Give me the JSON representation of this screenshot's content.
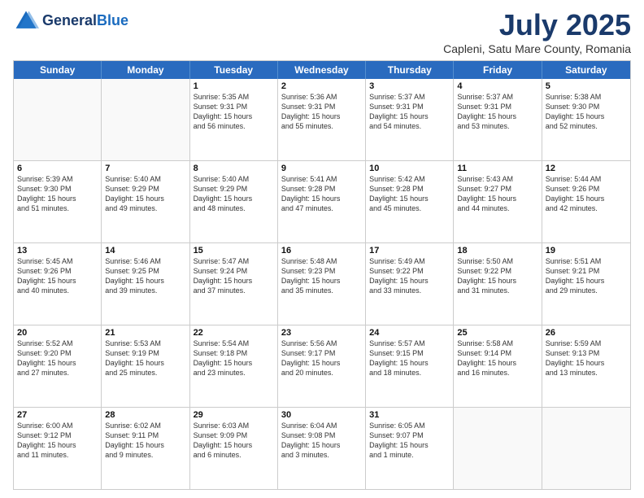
{
  "header": {
    "logo_general": "General",
    "logo_blue": "Blue",
    "main_title": "July 2025",
    "subtitle": "Capleni, Satu Mare County, Romania"
  },
  "calendar": {
    "days": [
      "Sunday",
      "Monday",
      "Tuesday",
      "Wednesday",
      "Thursday",
      "Friday",
      "Saturday"
    ],
    "rows": [
      [
        {
          "day": "",
          "empty": true
        },
        {
          "day": "",
          "empty": true
        },
        {
          "day": "1",
          "lines": [
            "Sunrise: 5:35 AM",
            "Sunset: 9:31 PM",
            "Daylight: 15 hours",
            "and 56 minutes."
          ]
        },
        {
          "day": "2",
          "lines": [
            "Sunrise: 5:36 AM",
            "Sunset: 9:31 PM",
            "Daylight: 15 hours",
            "and 55 minutes."
          ]
        },
        {
          "day": "3",
          "lines": [
            "Sunrise: 5:37 AM",
            "Sunset: 9:31 PM",
            "Daylight: 15 hours",
            "and 54 minutes."
          ]
        },
        {
          "day": "4",
          "lines": [
            "Sunrise: 5:37 AM",
            "Sunset: 9:31 PM",
            "Daylight: 15 hours",
            "and 53 minutes."
          ]
        },
        {
          "day": "5",
          "lines": [
            "Sunrise: 5:38 AM",
            "Sunset: 9:30 PM",
            "Daylight: 15 hours",
            "and 52 minutes."
          ]
        }
      ],
      [
        {
          "day": "6",
          "lines": [
            "Sunrise: 5:39 AM",
            "Sunset: 9:30 PM",
            "Daylight: 15 hours",
            "and 51 minutes."
          ]
        },
        {
          "day": "7",
          "lines": [
            "Sunrise: 5:40 AM",
            "Sunset: 9:29 PM",
            "Daylight: 15 hours",
            "and 49 minutes."
          ]
        },
        {
          "day": "8",
          "lines": [
            "Sunrise: 5:40 AM",
            "Sunset: 9:29 PM",
            "Daylight: 15 hours",
            "and 48 minutes."
          ]
        },
        {
          "day": "9",
          "lines": [
            "Sunrise: 5:41 AM",
            "Sunset: 9:28 PM",
            "Daylight: 15 hours",
            "and 47 minutes."
          ]
        },
        {
          "day": "10",
          "lines": [
            "Sunrise: 5:42 AM",
            "Sunset: 9:28 PM",
            "Daylight: 15 hours",
            "and 45 minutes."
          ]
        },
        {
          "day": "11",
          "lines": [
            "Sunrise: 5:43 AM",
            "Sunset: 9:27 PM",
            "Daylight: 15 hours",
            "and 44 minutes."
          ]
        },
        {
          "day": "12",
          "lines": [
            "Sunrise: 5:44 AM",
            "Sunset: 9:26 PM",
            "Daylight: 15 hours",
            "and 42 minutes."
          ]
        }
      ],
      [
        {
          "day": "13",
          "lines": [
            "Sunrise: 5:45 AM",
            "Sunset: 9:26 PM",
            "Daylight: 15 hours",
            "and 40 minutes."
          ]
        },
        {
          "day": "14",
          "lines": [
            "Sunrise: 5:46 AM",
            "Sunset: 9:25 PM",
            "Daylight: 15 hours",
            "and 39 minutes."
          ]
        },
        {
          "day": "15",
          "lines": [
            "Sunrise: 5:47 AM",
            "Sunset: 9:24 PM",
            "Daylight: 15 hours",
            "and 37 minutes."
          ]
        },
        {
          "day": "16",
          "lines": [
            "Sunrise: 5:48 AM",
            "Sunset: 9:23 PM",
            "Daylight: 15 hours",
            "and 35 minutes."
          ]
        },
        {
          "day": "17",
          "lines": [
            "Sunrise: 5:49 AM",
            "Sunset: 9:22 PM",
            "Daylight: 15 hours",
            "and 33 minutes."
          ]
        },
        {
          "day": "18",
          "lines": [
            "Sunrise: 5:50 AM",
            "Sunset: 9:22 PM",
            "Daylight: 15 hours",
            "and 31 minutes."
          ]
        },
        {
          "day": "19",
          "lines": [
            "Sunrise: 5:51 AM",
            "Sunset: 9:21 PM",
            "Daylight: 15 hours",
            "and 29 minutes."
          ]
        }
      ],
      [
        {
          "day": "20",
          "lines": [
            "Sunrise: 5:52 AM",
            "Sunset: 9:20 PM",
            "Daylight: 15 hours",
            "and 27 minutes."
          ]
        },
        {
          "day": "21",
          "lines": [
            "Sunrise: 5:53 AM",
            "Sunset: 9:19 PM",
            "Daylight: 15 hours",
            "and 25 minutes."
          ]
        },
        {
          "day": "22",
          "lines": [
            "Sunrise: 5:54 AM",
            "Sunset: 9:18 PM",
            "Daylight: 15 hours",
            "and 23 minutes."
          ]
        },
        {
          "day": "23",
          "lines": [
            "Sunrise: 5:56 AM",
            "Sunset: 9:17 PM",
            "Daylight: 15 hours",
            "and 20 minutes."
          ]
        },
        {
          "day": "24",
          "lines": [
            "Sunrise: 5:57 AM",
            "Sunset: 9:15 PM",
            "Daylight: 15 hours",
            "and 18 minutes."
          ]
        },
        {
          "day": "25",
          "lines": [
            "Sunrise: 5:58 AM",
            "Sunset: 9:14 PM",
            "Daylight: 15 hours",
            "and 16 minutes."
          ]
        },
        {
          "day": "26",
          "lines": [
            "Sunrise: 5:59 AM",
            "Sunset: 9:13 PM",
            "Daylight: 15 hours",
            "and 13 minutes."
          ]
        }
      ],
      [
        {
          "day": "27",
          "lines": [
            "Sunrise: 6:00 AM",
            "Sunset: 9:12 PM",
            "Daylight: 15 hours",
            "and 11 minutes."
          ]
        },
        {
          "day": "28",
          "lines": [
            "Sunrise: 6:02 AM",
            "Sunset: 9:11 PM",
            "Daylight: 15 hours",
            "and 9 minutes."
          ]
        },
        {
          "day": "29",
          "lines": [
            "Sunrise: 6:03 AM",
            "Sunset: 9:09 PM",
            "Daylight: 15 hours",
            "and 6 minutes."
          ]
        },
        {
          "day": "30",
          "lines": [
            "Sunrise: 6:04 AM",
            "Sunset: 9:08 PM",
            "Daylight: 15 hours",
            "and 3 minutes."
          ]
        },
        {
          "day": "31",
          "lines": [
            "Sunrise: 6:05 AM",
            "Sunset: 9:07 PM",
            "Daylight: 15 hours",
            "and 1 minute."
          ]
        },
        {
          "day": "",
          "empty": true
        },
        {
          "day": "",
          "empty": true
        }
      ]
    ]
  }
}
